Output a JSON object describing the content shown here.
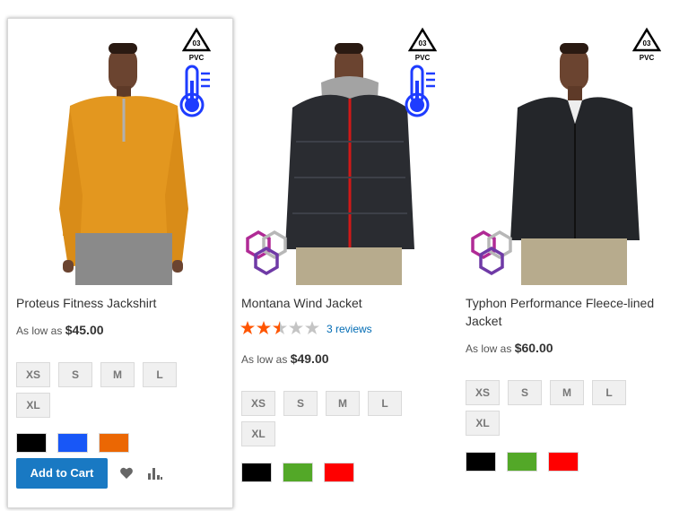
{
  "products": [
    {
      "name": "Proteus Fitness Jackshirt",
      "price_prefix": "As low as",
      "price": "$45.00",
      "sizes": [
        "XS",
        "S",
        "M",
        "L",
        "XL"
      ],
      "colors": [
        "#000000",
        "#1857f7",
        "#eb6703"
      ],
      "shirt_color": "#e3971f",
      "badges": [
        "pvc-03-icon",
        "thermometer-icon"
      ],
      "add_to_cart": "Add to Cart"
    },
    {
      "name": "Montana Wind Jacket",
      "rating": 2.5,
      "reviews": "3 reviews",
      "price_prefix": "As low as",
      "price": "$49.00",
      "sizes": [
        "XS",
        "S",
        "M",
        "L",
        "XL"
      ],
      "colors": [
        "#000000",
        "#53a828",
        "#ff0000"
      ],
      "shirt_color": "#2a2c31",
      "badges": [
        "pvc-03-icon",
        "thermometer-icon",
        "eco-hexagon-icon"
      ]
    },
    {
      "name_line1": "Typhon Performance Fleece-lined",
      "name_line2": "Jacket",
      "price_prefix": "As low as",
      "price": "$60.00",
      "sizes": [
        "XS",
        "S",
        "M",
        "L",
        "XL"
      ],
      "colors": [
        "#000000",
        "#53a828",
        "#ff0000"
      ],
      "shirt_color": "#24262a",
      "badges": [
        "pvc-03-icon",
        "eco-hexagon-icon"
      ]
    }
  ],
  "badge_text": {
    "pvc_number": "03",
    "pvc_label": "PVC"
  },
  "colors": {
    "accent": "#1979c3",
    "star": "#ff5501",
    "link": "#006bb4"
  }
}
